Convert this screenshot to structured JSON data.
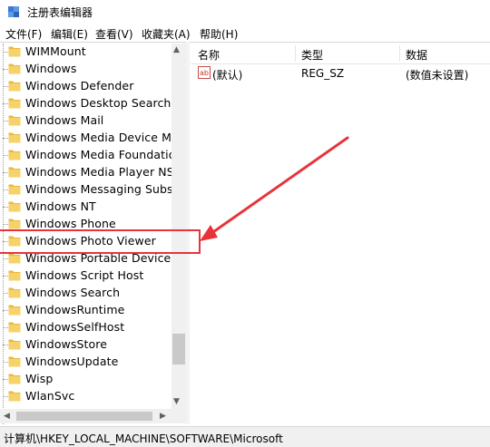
{
  "window": {
    "title": "注册表编辑器"
  },
  "menu": [
    "文件(F)",
    "编辑(E)",
    "查看(V)",
    "收藏夹(A)",
    "帮助(H)"
  ],
  "tree": {
    "items": [
      "WIMMount",
      "Windows",
      "Windows Defender",
      "Windows Desktop Search",
      "Windows Mail",
      "Windows Media Device Mana",
      "Windows Media Foundation",
      "Windows Media Player NSS",
      "Windows Messaging Subsyst",
      "Windows NT",
      "Windows Phone",
      "Windows Photo Viewer",
      "Windows Portable Devices",
      "Windows Script Host",
      "Windows Search",
      "WindowsRuntime",
      "WindowsSelfHost",
      "WindowsStore",
      "WindowsUpdate",
      "Wisp",
      "WlanSvc"
    ],
    "highlighted": "Windows Photo Viewer"
  },
  "columns": {
    "name": "名称",
    "type": "类型",
    "data": "数据"
  },
  "values": [
    {
      "icon": "ab-string-icon",
      "name": "(默认)",
      "type": "REG_SZ",
      "data": "(数值未设置)"
    }
  ],
  "status": {
    "path": "计算机\\HKEY_LOCAL_MACHINE\\SOFTWARE\\Microsoft"
  },
  "colors": {
    "annotation": "#e8333a",
    "folder": "#f6d26a"
  }
}
